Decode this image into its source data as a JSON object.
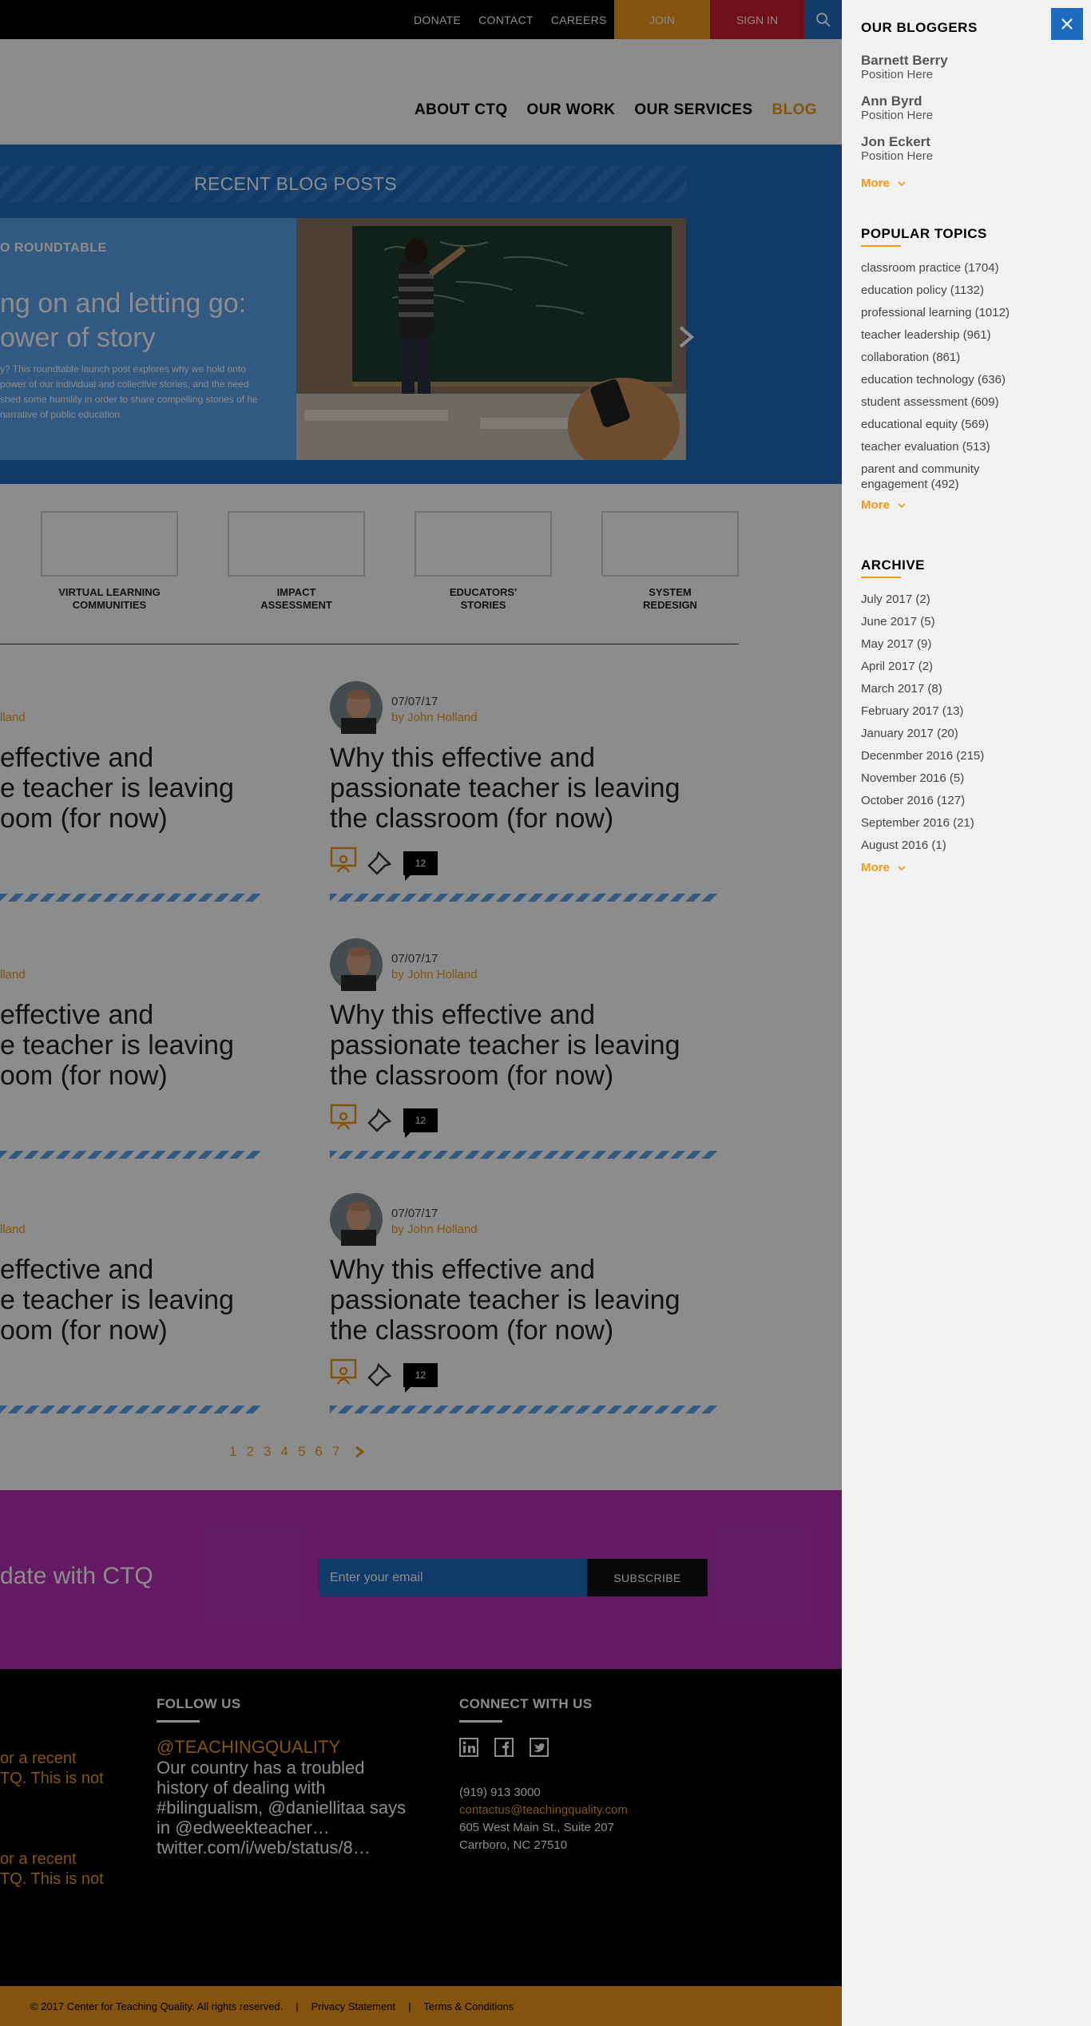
{
  "topbar": {
    "links": [
      "DONATE",
      "CONTACT",
      "CAREERS"
    ],
    "join_label": "JOIN",
    "signin_label": "SIGN IN"
  },
  "nav": {
    "items": [
      {
        "label": "ABOUT CTQ"
      },
      {
        "label": "OUR WORK"
      },
      {
        "label": "OUR SERVICES"
      },
      {
        "label": "BLOG"
      }
    ],
    "active": "BLOG"
  },
  "hero": {
    "section_title": "RECENT BLOG POSTS",
    "category": "O ROUNDTABLE",
    "headline_line1": "ng on and letting go:",
    "headline_line2": "ower of story",
    "excerpt": "y? This roundtable launch post explores why we hold onto power of our individual and collective stories, and the need shed some humility in order to share compelling stories of he narrative of public education."
  },
  "features": [
    {
      "line1": "VIRTUAL LEARNING",
      "line2": "COMMUNITIES"
    },
    {
      "line1": "IMPACT",
      "line2": "ASSESSMENT"
    },
    {
      "line1": "EDUCATORS'",
      "line2": "STORIES"
    },
    {
      "line1": "SYSTEM",
      "line2": "REDESIGN"
    }
  ],
  "posts_left": [
    {
      "author": "lland",
      "title": "effective and\ne teacher is leaving\noom (for now)"
    },
    {
      "author": "lland",
      "title": "effective and\ne teacher is leaving\noom (for now)"
    },
    {
      "author": "lland",
      "title": "effective and\ne teacher is leaving\noom (for now)"
    }
  ],
  "posts_right": [
    {
      "date": "07/07/17",
      "author": "by John Holland",
      "title": "Why this effective and passionate teacher is leaving the classroom (for now)",
      "comments": "12"
    },
    {
      "date": "07/07/17",
      "author": "by John Holland",
      "title": "Why this effective and passionate teacher is leaving the classroom (for now)",
      "comments": "12"
    },
    {
      "date": "07/07/17",
      "author": "by John Holland",
      "title": "Why this effective and passionate teacher is leaving the classroom (for now)",
      "comments": "12"
    }
  ],
  "pagination": {
    "pages": [
      "1",
      "2",
      "3",
      "4",
      "5",
      "6",
      "7"
    ]
  },
  "newsletter": {
    "text": "date with CTQ",
    "placeholder": "Enter your email",
    "button": "SUBSCRIBE"
  },
  "footer": {
    "follow_heading": "FOLLOW US",
    "handle": "@TEACHINGQUALITY",
    "tweet": "Our country has a troubled history of dealing with #bilingualism, @daniellitaa says in @edweekteacher… twitter.com/i/web/status/8…",
    "connect_heading": "CONNECT WITH US",
    "left_snippet1_line1": "or a recent",
    "left_snippet1_line2": "TQ. This is not",
    "left_snippet2_line1": "or a recent",
    "left_snippet2_line2": "TQ. This is not",
    "phone": "(919) 913 3000",
    "email": "contactus@teachingquality.com",
    "address1": "605 West Main St., Suite 207",
    "address2": "Carrboro, NC 27510",
    "copyright": "© 2017 Center for Teaching Quality. All rights reserved.",
    "sep": "|",
    "privacy": "Privacy Statement",
    "terms": "Terms & Conditions"
  },
  "sidebar": {
    "bloggers_heading": "OUR BLOGGERS",
    "bloggers": [
      {
        "name": "Barnett Berry",
        "position": "Position Here"
      },
      {
        "name": "Ann Byrd",
        "position": "Position Here"
      },
      {
        "name": "Jon Eckert",
        "position": "Position Here"
      }
    ],
    "more_label": "More",
    "topics_heading": "POPULAR TOPICS",
    "topics": [
      "classroom practice (1704)",
      "education policy (1132)",
      "professional learning (1012)",
      "teacher leadership (961)",
      "collaboration (861)",
      "education technology (636)",
      "student assessment (609)",
      "educational equity (569)",
      "teacher evaluation (513)",
      "parent and community engagement (492)"
    ],
    "archive_heading": "ARCHIVE",
    "archive": [
      "July 2017 (2)",
      "June 2017 (5)",
      "May 2017 (9)",
      "April 2017 (2)",
      "March 2017 (8)",
      "February 2017 (13)",
      "January 2017 (20)",
      "Decenmber 2016 (215)",
      "November 2016 (5)",
      "October 2016 (127)",
      "September 2016 (21)",
      "August 2016 (1)"
    ]
  },
  "colors": {
    "orange": "#f09a1a",
    "blue": "#1e6cc0",
    "light_blue": "#5aa2ec",
    "red": "#cc1a2e",
    "magenta": "#b431b4",
    "overlay": "rgba(0,0,0,0.45)"
  },
  "icons": [
    "search-icon",
    "close-icon",
    "chevron-right-icon",
    "chevron-down-icon",
    "presenter-icon",
    "pin-icon",
    "comment-icon",
    "linkedin-icon",
    "facebook-icon",
    "twitter-icon"
  ]
}
